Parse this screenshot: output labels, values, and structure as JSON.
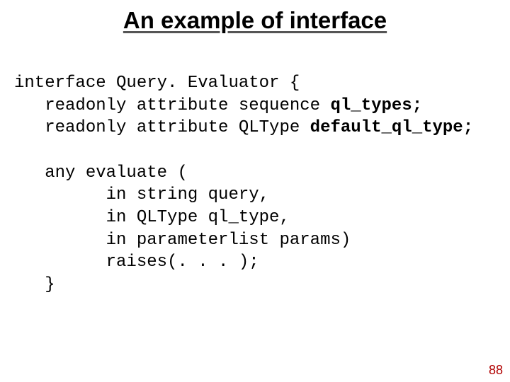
{
  "title": "An example of interface",
  "code": {
    "l1a": "interface Query. Evaluator {",
    "l2a": "   readonly attribute sequence ",
    "l2b": "ql_types;",
    "l3a": "   readonly attribute QLType ",
    "l3b": "default_ql_type;",
    "l4": "",
    "l5": "   any evaluate (",
    "l6": "         in string query,",
    "l7": "         in QLType ql_type,",
    "l8": "         in parameterlist params)",
    "l9": "         raises(. . . );",
    "l10": "   }"
  },
  "page_number": "88"
}
